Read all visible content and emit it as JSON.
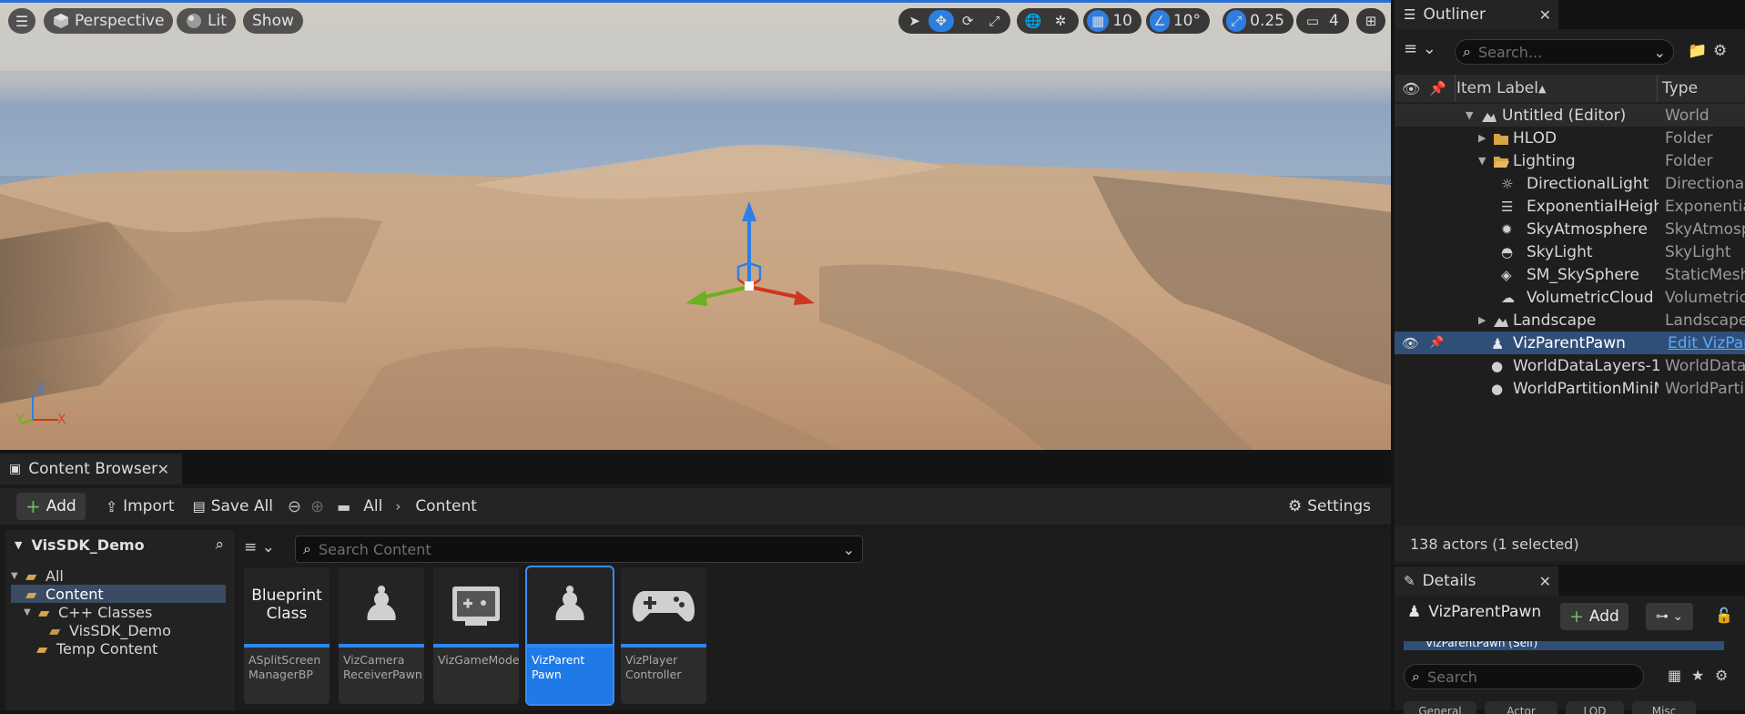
{
  "viewport": {
    "view_mode": "Perspective",
    "lighting": "Lit",
    "show": "Show",
    "grid_snap": "10",
    "rotation_snap": "10°",
    "scale_snap": "0.25",
    "camera_speed": "4",
    "axis_z": "Z",
    "axis_x": "X",
    "axis_y": "Y"
  },
  "outliner": {
    "tab_title": "Outliner",
    "search_placeholder": "Search...",
    "col_label": "Item Label",
    "col_type": "Type",
    "items": [
      {
        "label": "Untitled (Editor)",
        "type": "World",
        "icon": "world-icon"
      },
      {
        "label": "HLOD",
        "type": "Folder",
        "icon": "folder-icon"
      },
      {
        "label": "Lighting",
        "type": "Folder",
        "icon": "folder-open-icon"
      },
      {
        "label": "DirectionalLight",
        "type": "Directional",
        "icon": "sun-icon"
      },
      {
        "label": "ExponentialHeightF",
        "type": "Exponentia",
        "icon": "fog-icon"
      },
      {
        "label": "SkyAtmosphere",
        "type": "SkyAtmosp",
        "icon": "atmosphere-icon"
      },
      {
        "label": "SkyLight",
        "type": "SkyLight",
        "icon": "skylight-icon"
      },
      {
        "label": "SM_SkySphere",
        "type": "StaticMesh",
        "icon": "cube-icon"
      },
      {
        "label": "VolumetricCloud",
        "type": "Volumetric",
        "icon": "cloud-icon"
      },
      {
        "label": "Landscape",
        "type": "Landscape",
        "icon": "landscape-icon"
      },
      {
        "label": "VizParentPawn",
        "type": "Edit VizPar",
        "icon": "pawn-icon"
      },
      {
        "label": "WorldDataLayers-1",
        "type": "WorldData",
        "icon": "sphere-icon"
      },
      {
        "label": "WorldPartitionMiniM",
        "type": "WorldParti",
        "icon": "sphere-icon"
      }
    ],
    "status": "138 actors (1 selected)"
  },
  "details": {
    "tab_title": "Details",
    "actor_name": "VizParentPawn",
    "add_label": "Add",
    "search_placeholder": "Search",
    "partial_row": "VizParentPawn (Self)",
    "filter_tabs": [
      "General",
      "Actor",
      "LOD",
      "Misc"
    ]
  },
  "content_browser": {
    "tab_title": "Content Browser",
    "add_label": "Add",
    "import_label": "Import",
    "save_all_label": "Save All",
    "crumb_all": "All",
    "crumb_content": "Content",
    "settings_label": "Settings",
    "project_name": "VisSDK_Demo",
    "search_placeholder": "Search Content",
    "folders": [
      {
        "label": "All"
      },
      {
        "label": "Content"
      },
      {
        "label": "C++ Classes"
      },
      {
        "label": "VisSDK_Demo"
      },
      {
        "label": "Temp Content"
      }
    ],
    "assets": [
      {
        "thumb": "Blueprint Class",
        "name": "ASplitScreen ManagerBP"
      },
      {
        "thumb": "",
        "name": "VizCamera ReceiverPawn"
      },
      {
        "thumb": "",
        "name": "VizGameMode"
      },
      {
        "thumb": "",
        "name": "VizParent Pawn"
      },
      {
        "thumb": "",
        "name": "VizPlayer Controller"
      }
    ]
  },
  "colors": {
    "accent": "#2e7de0",
    "selection": "#1f7ae8",
    "folder": "#d9a548"
  }
}
